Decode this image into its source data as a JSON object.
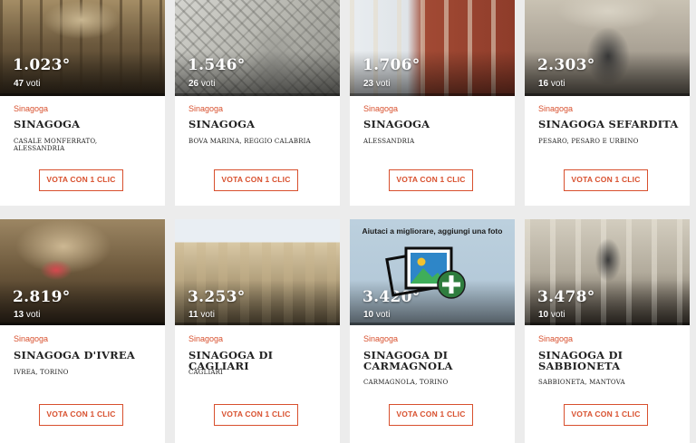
{
  "vote_label": "VOTA CON 1 CLIC",
  "votes_word": "voti",
  "cards": [
    {
      "rank": "1.023°",
      "votes": "47",
      "category": "Sinagoga",
      "name": "SINAGOGA",
      "location": "CASALE MONFERRATO, ALESSANDRIA"
    },
    {
      "rank": "1.546°",
      "votes": "26",
      "category": "Sinagoga",
      "name": "SINAGOGA",
      "location": "BOVA MARINA, REGGIO CALABRIA"
    },
    {
      "rank": "1.706°",
      "votes": "23",
      "category": "Sinagoga",
      "name": "SINAGOGA",
      "location": "ALESSANDRIA"
    },
    {
      "rank": "2.303°",
      "votes": "16",
      "category": "Sinagoga",
      "name": "SINAGOGA SEFARDITA",
      "location": "PESARO, PESARO E URBINO"
    },
    {
      "rank": "2.819°",
      "votes": "13",
      "category": "Sinagoga",
      "name": "SINAGOGA D'IVREA",
      "location": "IVREA, TORINO"
    },
    {
      "rank": "3.253°",
      "votes": "11",
      "category": "Sinagoga",
      "name": "SINAGOGA DI CAGLIARI",
      "location": "CAGLIARI"
    },
    {
      "rank": "3.420°",
      "votes": "10",
      "category": "Sinagoga",
      "name": "SINAGOGA DI CARMAGNOLA",
      "location": "CARMAGNOLA, TORINO",
      "photo_prompt": "Aiutaci a migliorare, aggiungi una foto"
    },
    {
      "rank": "3.478°",
      "votes": "10",
      "category": "Sinagoga",
      "name": "SINAGOGA DI SABBIONETA",
      "location": "SABBIONETA, MANTOVA"
    }
  ],
  "colors": {
    "accent": "#d8502e",
    "card_bg": "#ffffff",
    "page_bg": "#ececec"
  },
  "icons": {
    "add_photo": "add-photo-icon"
  }
}
